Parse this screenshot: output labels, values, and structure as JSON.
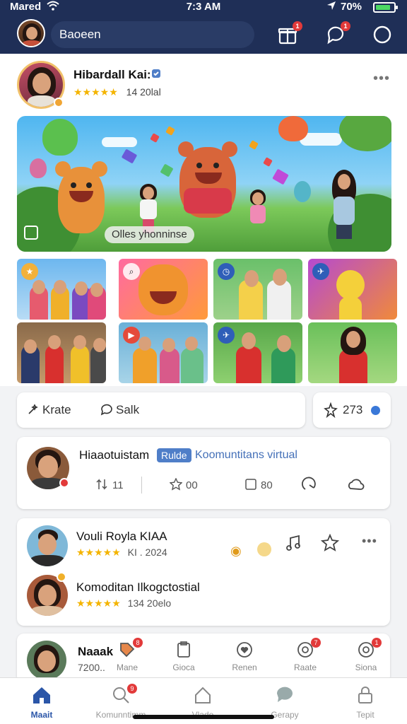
{
  "status_bar": {
    "carrier": "Mared",
    "time": "7:3 AM",
    "battery": "70%"
  },
  "header": {
    "search_text": "Baoeen",
    "gift_badge": "1",
    "chat_badge": "1"
  },
  "profile": {
    "name": "Hibardall Kai:",
    "stars": "★★★★★",
    "rating_text": "14  20lal"
  },
  "hero": {
    "caption": "Olles yhonninse"
  },
  "actions": {
    "first_label": "Krate",
    "second_label": "Salk",
    "count": "273"
  },
  "post": {
    "name": "Hiaaotuistam",
    "pill": "Rulde",
    "subtitle": "Koomuntitans virtual",
    "stat1": "11",
    "stat2": "00",
    "stat3": "80"
  },
  "people": [
    {
      "name": "Vouli Royla KIAA",
      "stars": "★★★★★",
      "meta": "KI . 2024"
    },
    {
      "name": "Komoditan Ilkogctostial",
      "stars": "★★★★★",
      "meta": "134  20elo"
    }
  ],
  "partial_card": {
    "name": "Naaak",
    "meta": "7200.."
  },
  "mini_tabs": [
    {
      "label": "Mane",
      "badge": "8"
    },
    {
      "label": "Gioca",
      "badge": ""
    },
    {
      "label": "Renen",
      "badge": ""
    },
    {
      "label": "Raate",
      "badge": "7"
    },
    {
      "label": "Siona",
      "badge": "1"
    }
  ],
  "bottom_nav": [
    {
      "label": "Maait",
      "active": true
    },
    {
      "label": "Komunntimm",
      "badge": "9"
    },
    {
      "label": "Vlado"
    },
    {
      "label": "Gerapy"
    },
    {
      "label": "Tepit"
    }
  ],
  "colors": {
    "header_bg": "#1f2f57",
    "accent": "#2b56a8",
    "star": "#f4b400",
    "badge": "#e23a3a"
  }
}
